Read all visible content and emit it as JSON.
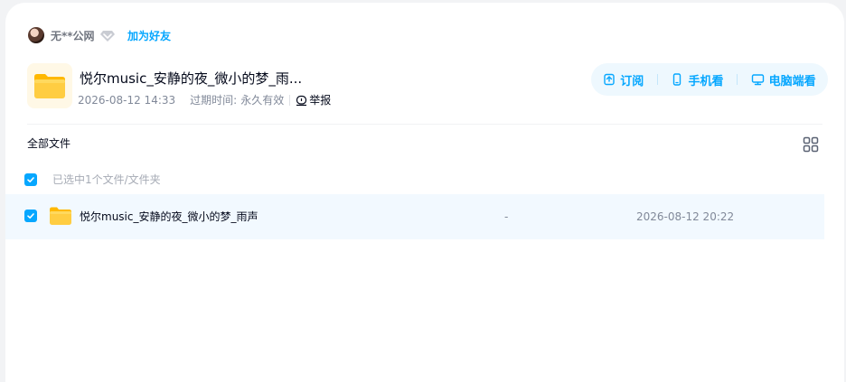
{
  "user": {
    "name": "无**公网",
    "add_friend": "加为好友"
  },
  "share": {
    "title": "悦尔music_安静的夜_微小的梦_雨...",
    "created": "2026-08-12 14:33",
    "expire_label": "过期时间:",
    "expire_value": "永久有效",
    "report": "举报"
  },
  "actions": {
    "subscribe": "订阅",
    "phone": "手机看",
    "pc": "电脑端看"
  },
  "list": {
    "breadcrumb": "全部文件",
    "selected_text": "已选中1个文件/文件夹",
    "rows": [
      {
        "name": "悦尔music_安静的夜_微小的梦_雨声",
        "size": "-",
        "date": "2026-08-12 20:22"
      }
    ]
  },
  "colors": {
    "accent": "#06a7ff",
    "folder": "#ffc93b",
    "row_selected": "#f2f9ff"
  },
  "icons": [
    "avatar",
    "diamond-vip-icon",
    "folder-icon",
    "report-icon",
    "subscribe-icon",
    "phone-icon",
    "monitor-icon",
    "grid-view-icon",
    "checkbox-checked-icon"
  ]
}
